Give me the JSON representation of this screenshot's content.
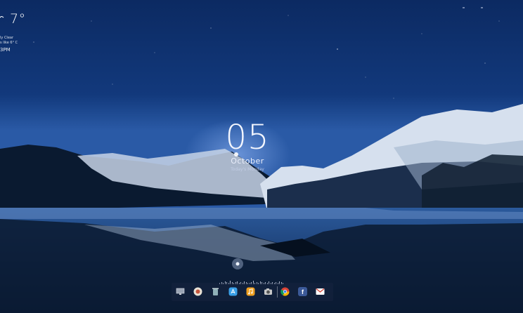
{
  "weather": {
    "temperature": "7°",
    "condition": "ly Clear",
    "feels_like": "s like 6° C",
    "time": "3PM",
    "icon": "cloud-icon"
  },
  "clock": {
    "day": "05",
    "month": "October",
    "weekday": "Today's Monday"
  },
  "dock": {
    "items": [
      {
        "name": "desktop-monitor",
        "icon": "monitor-icon",
        "color": "#9aa4b4"
      },
      {
        "name": "finder",
        "icon": "finder-icon",
        "color": "#e8e2d6"
      },
      {
        "name": "trash",
        "icon": "trash-icon",
        "color": "#8fb0b8"
      },
      {
        "name": "app-store",
        "icon": "app-store-icon",
        "color": "#3aa0e8"
      },
      {
        "name": "music",
        "icon": "music-icon",
        "color": "#f0a020"
      },
      {
        "name": "camera",
        "icon": "camera-icon",
        "color": "#c8c8c8"
      },
      {
        "name": "chrome",
        "icon": "chrome-icon",
        "color": "#4285f4"
      },
      {
        "name": "facebook",
        "icon": "facebook-icon",
        "color": "#3b5998"
      },
      {
        "name": "gmail",
        "icon": "gmail-icon",
        "color": "#d44638"
      }
    ]
  }
}
